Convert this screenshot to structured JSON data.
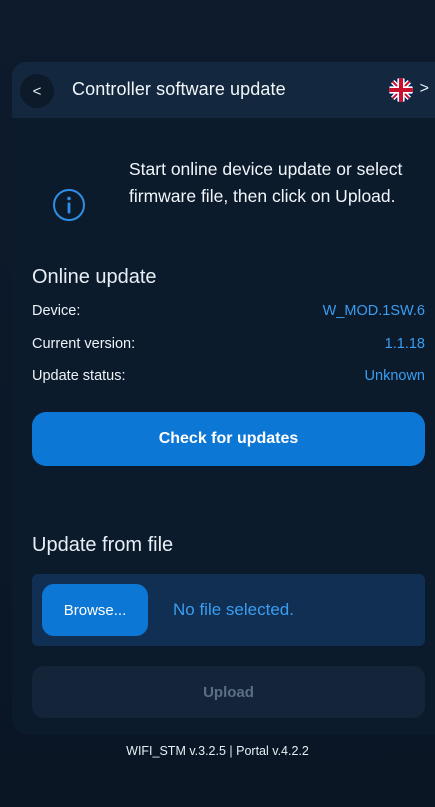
{
  "header": {
    "title": "Controller software update",
    "back_glyph": "<",
    "lang_chevron_glyph": ">",
    "flag_icon": "uk-flag-icon"
  },
  "info": {
    "icon": "info-icon",
    "message": "Start online device update or select firmware file, then click on Upload."
  },
  "online_update": {
    "title": "Online update",
    "rows": [
      {
        "label": "Device:",
        "value": "W_MOD.1SW.6"
      },
      {
        "label": "Current version:",
        "value": "1.1.18"
      },
      {
        "label": "Update status:",
        "value": "Unknown"
      }
    ],
    "check_button": "Check for updates"
  },
  "file_update": {
    "title": "Update from file",
    "browse_button": "Browse...",
    "file_status": "No file selected.",
    "upload_button": "Upload"
  },
  "footer": "WIFI_STM v.3.2.5 | Portal v.4.2.2",
  "colors": {
    "accent": "#0d77d6",
    "value_text": "#3a9df0",
    "background": "#0c1b2c"
  }
}
